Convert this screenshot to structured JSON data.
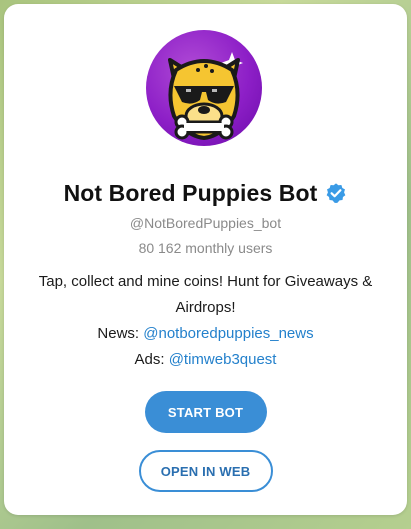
{
  "bot": {
    "name": "Not Bored Puppies Bot",
    "username": "@NotBoredPuppies_bot",
    "monthly_users": "80 162 monthly users",
    "verified_icon": "verified-badge-icon",
    "avatar_icon": "puppy-sunglasses-avatar"
  },
  "description": {
    "line1": "Tap, collect and mine coins! Hunt for Giveaways &",
    "line2": "Airdrops!",
    "news_label": "News:",
    "news_link": "@notboredpuppies_news",
    "ads_label": "Ads:",
    "ads_link": "@timweb3quest"
  },
  "buttons": {
    "start": "START BOT",
    "open_web": "OPEN IN WEB"
  },
  "colors": {
    "accent": "#3a8ed6",
    "link": "#2481cc",
    "avatar_bg": "#8d1fc7",
    "dog_yellow": "#f5c531"
  }
}
